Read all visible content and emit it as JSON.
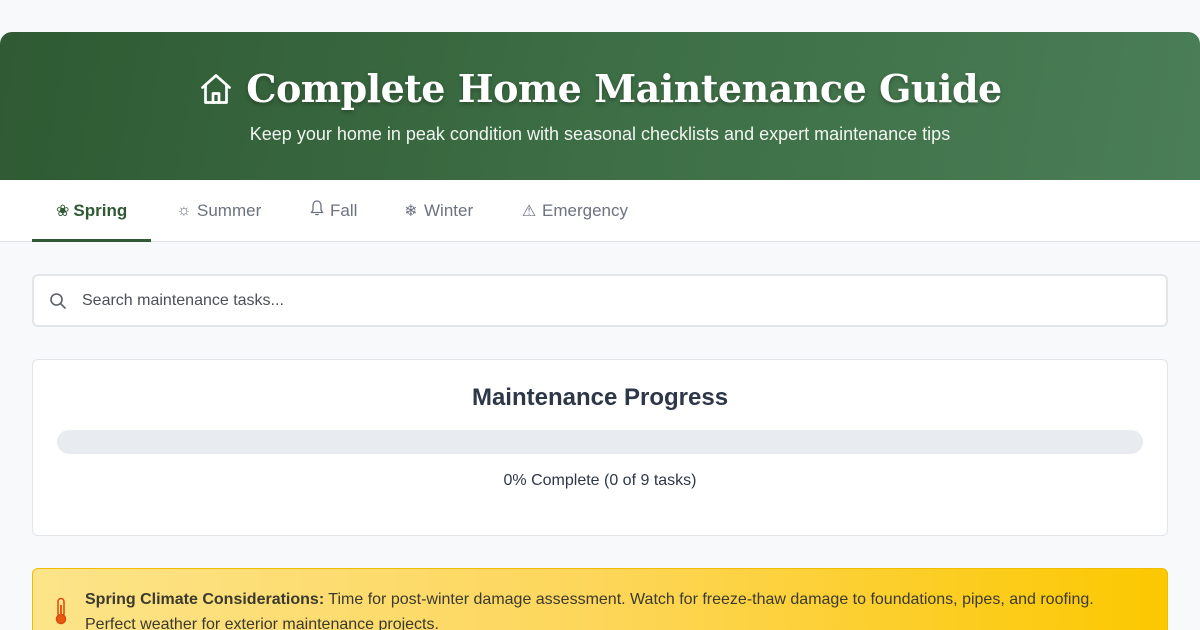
{
  "header": {
    "title": "Complete Home Maintenance Guide",
    "subtitle": "Keep your home in peak condition with seasonal checklists and expert maintenance tips",
    "icon": "home-icon"
  },
  "tabs": [
    {
      "label": "Spring",
      "icon": "flower-icon",
      "glyph": "❀",
      "active": true
    },
    {
      "label": "Summer",
      "icon": "sun-icon",
      "glyph": "☼",
      "active": false
    },
    {
      "label": "Fall",
      "icon": "bell-icon",
      "glyph": "🔔",
      "active": false
    },
    {
      "label": "Winter",
      "icon": "snowflake-icon",
      "glyph": "❄",
      "active": false
    },
    {
      "label": "Emergency",
      "icon": "warning-icon",
      "glyph": "⚠",
      "active": false
    }
  ],
  "search": {
    "placeholder": "Search maintenance tasks...",
    "value": ""
  },
  "progress": {
    "title": "Maintenance Progress",
    "percent": 0,
    "completed": 0,
    "total": 9,
    "status_text": "0% Complete (0 of 9 tasks)"
  },
  "climate": {
    "heading": "Spring Climate Considerations:",
    "body": "Time for post-winter damage assessment. Watch for freeze-thaw damage to foundations, pipes, and roofing. Perfect weather for exterior maintenance projects."
  },
  "colors": {
    "brand_green": "#2f5a33",
    "warning_yellow": "#fcc800"
  }
}
